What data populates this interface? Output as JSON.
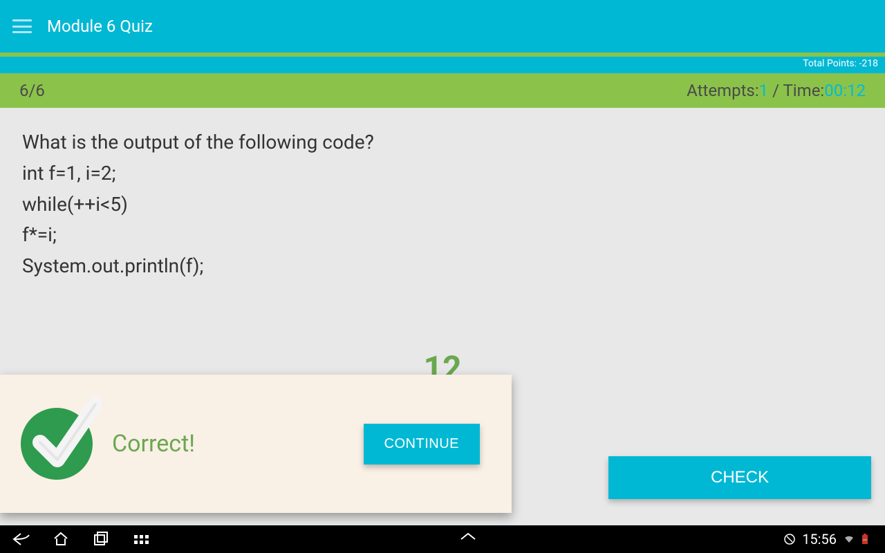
{
  "header": {
    "title": "Module 6 Quiz"
  },
  "points": {
    "label": "Total Points: -218"
  },
  "status": {
    "progress": "6/6",
    "attempts_label": "Attempts:",
    "attempts_value": "1",
    "sep": " / ",
    "time_label": "Time:",
    "time_value": "00:12"
  },
  "question": {
    "text": "What is the output of the following code?\nint f=1, i=2;\nwhile(++i<5)\n   f*=i;\nSystem.out.println(f);"
  },
  "answer": {
    "shown": "12"
  },
  "toast": {
    "text": "Correct!",
    "continue": "CONTINUE"
  },
  "actions": {
    "check": "CHECK"
  },
  "navbar": {
    "time": "15:56"
  }
}
